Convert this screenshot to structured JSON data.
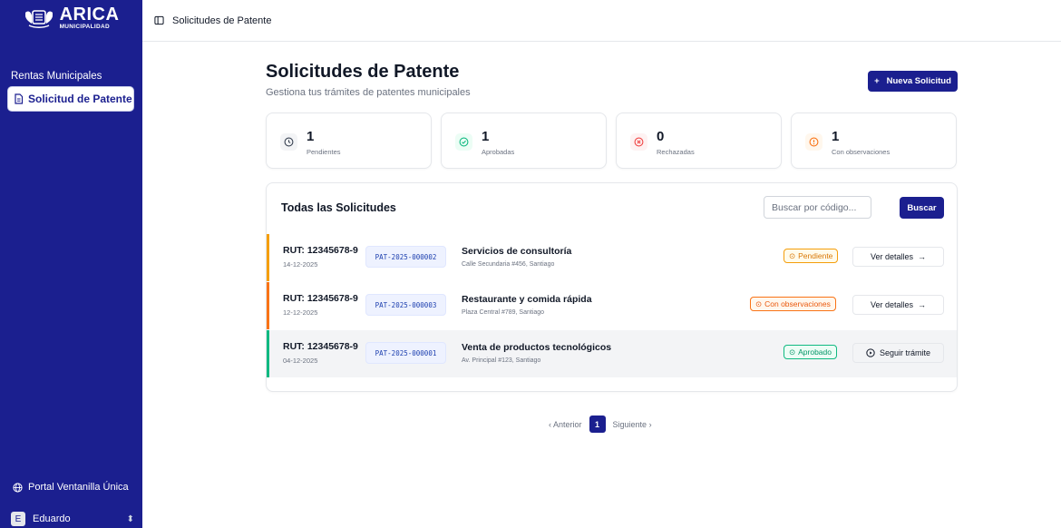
{
  "brand": {
    "title": "ARICA",
    "subtitle": "MUNICIPALIDAD"
  },
  "sidebar": {
    "items": [
      {
        "label": "Rentas Municipales"
      },
      {
        "label": "Solicitud de Patente",
        "active": true
      }
    ],
    "portal_label": "Portal Ventanilla Única",
    "user": {
      "initial": "E",
      "name": "Eduardo"
    }
  },
  "topbar": {
    "breadcrumb": "Solicitudes de Patente"
  },
  "header": {
    "title": "Solicitudes de Patente",
    "subtitle": "Gestiona tus trámites de patentes municipales",
    "new_button": "Nueva Solicitud",
    "new_button_icon": "+"
  },
  "stats": [
    {
      "value": "1",
      "label": "Pendientes",
      "color": "#6b7280"
    },
    {
      "value": "1",
      "label": "Aprobadas",
      "color": "#10b981"
    },
    {
      "value": "0",
      "label": "Rechazadas",
      "color": "#ef4444"
    },
    {
      "value": "1",
      "label": "Con observaciones",
      "color": "#f97316"
    }
  ],
  "requests": {
    "title": "Todas las Solicitudes",
    "search_placeholder": "Buscar por código...",
    "search_button": "Buscar",
    "rows": [
      {
        "rut": "RUT: 12345678-9",
        "date": "14-12-2025",
        "code": "PAT-2025-000002",
        "service": "Servicios de consultoría",
        "address": "Calle Secundaria #456, Santiago",
        "status": "Pendiente",
        "action": "Ver detalles",
        "bar_color": "#f59e0b"
      },
      {
        "rut": "RUT: 12345678-9",
        "date": "12-12-2025",
        "code": "PAT-2025-000003",
        "service": "Restaurante y comida rápida",
        "address": "Plaza Central #789, Santiago",
        "status": "Con observaciones",
        "action": "Ver detalles",
        "bar_color": "#f97316"
      },
      {
        "rut": "RUT: 12345678-9",
        "date": "04-12-2025",
        "code": "PAT-2025-000001",
        "service": "Venta de productos tecnológicos",
        "address": "Av. Principal #123, Santiago",
        "status": "Aprobado",
        "action": "Seguir trámite",
        "bar_color": "#10b981"
      }
    ]
  },
  "pagination": {
    "prev": "Anterior",
    "current": "1",
    "next": "Siguiente"
  }
}
